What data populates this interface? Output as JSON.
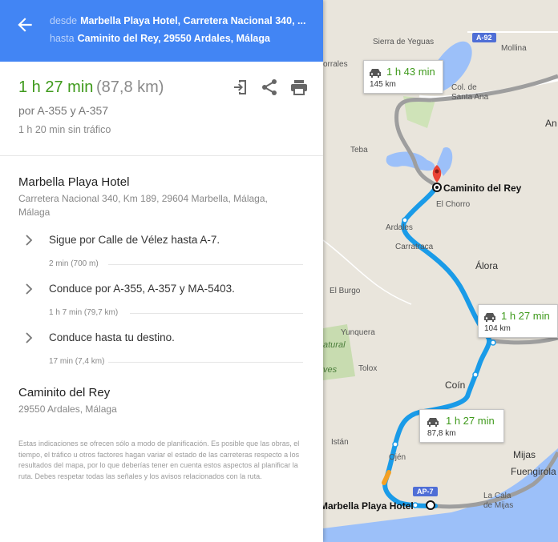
{
  "header": {
    "from_label": "desde",
    "from_value": "Marbella Playa Hotel, Carretera Nacional 340, ...",
    "to_label": "hasta",
    "to_value": "Caminito del Rey, 29550 Ardales, Málaga"
  },
  "summary": {
    "duration": "1 h 27 min",
    "distance": "(87,8 km)",
    "via": "por A-355 y A-357",
    "no_traffic": "1 h 20 min sin tráfico"
  },
  "origin": {
    "name": "Marbella Playa Hotel",
    "address": "Carretera Nacional 340, Km 189, 29604 Marbella, Málaga, Málaga"
  },
  "steps": [
    {
      "text": "Sigue por Calle de Vélez hasta A-7.",
      "meta": "2 min (700 m)"
    },
    {
      "text": "Conduce por A-355, A-357 y MA-5403.",
      "meta": "1 h 7 min (79,7 km)"
    },
    {
      "text": "Conduce hasta tu destino.",
      "meta": "17 min (7,4 km)"
    }
  ],
  "destination": {
    "name": "Caminito del Rey",
    "address": "29550 Ardales, Málaga"
  },
  "disclaimer": "Estas indicaciones se ofrecen sólo a modo de planificación. Es posible que las obras, el tiempo, el tráfico u otros factores hagan variar el estado de las carreteras respecto a los resultados del mapa, por lo que deberías tener en cuenta estos aspectos al planificar la ruta. Debes respetar todas las señales y los avisos relacionados con la ruta.",
  "map": {
    "labels": {
      "sierra": "Sierra de Yeguas",
      "mollina": "Mollina",
      "a92": "A-92",
      "orrales": "orrales",
      "col_santa_ana": "Col. de Santa Ana",
      "an": "An",
      "teba": "Teba",
      "caminito": "Caminito del Rey",
      "el_chorro": "El Chorro",
      "ardales": "Ardales",
      "carratraca": "Carratraca",
      "alora": "Álora",
      "el_burgo": "El Burgo",
      "yunquera": "Yunquera",
      "natural": "atural",
      "ves": "ves",
      "tolox": "Tolox",
      "coin": "Coín",
      "istan": "Istán",
      "ojen": "Ojén",
      "mijas": "Mijas",
      "fuengirola": "Fuengirola",
      "la_cala": "La Cala de Mijas",
      "ap7": "AP-7",
      "marbella": "Marbella Playa Hotel"
    },
    "callouts": [
      {
        "time": "1 h 43 min",
        "dist": "145 km"
      },
      {
        "time": "1 h 27 min",
        "dist": "104 km"
      },
      {
        "time": "1 h 27 min",
        "dist": "87,8 km"
      }
    ],
    "colors": {
      "route": "#1a9be8",
      "alt_route": "#9e9e9e",
      "water": "#9cc0f9",
      "land": "#e9e5dc",
      "traffic": "#f4a023"
    }
  }
}
